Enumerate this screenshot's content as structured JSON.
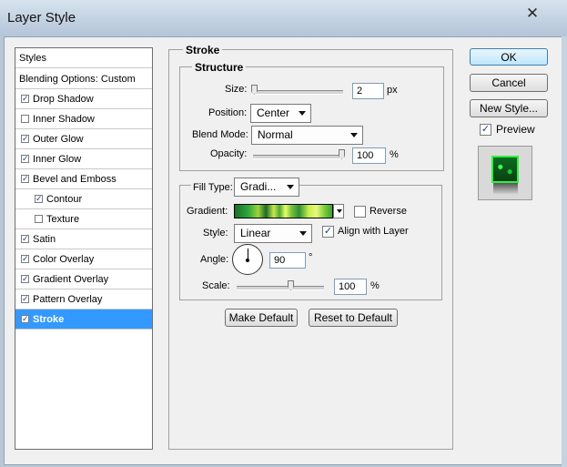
{
  "window": {
    "title": "Layer Style",
    "close_glyph": "✕"
  },
  "styles_panel": {
    "header": "Styles",
    "items": [
      {
        "label": "Blending Options: Custom",
        "checkbox": false
      },
      {
        "label": "Drop Shadow",
        "checkbox": true,
        "checked": true
      },
      {
        "label": "Inner Shadow",
        "checkbox": true,
        "checked": false
      },
      {
        "label": "Outer Glow",
        "checkbox": true,
        "checked": true
      },
      {
        "label": "Inner Glow",
        "checkbox": true,
        "checked": true
      },
      {
        "label": "Bevel and Emboss",
        "checkbox": true,
        "checked": true
      },
      {
        "label": "Contour",
        "checkbox": true,
        "checked": true,
        "sub": true
      },
      {
        "label": "Texture",
        "checkbox": true,
        "checked": false,
        "sub": true
      },
      {
        "label": "Satin",
        "checkbox": true,
        "checked": true
      },
      {
        "label": "Color Overlay",
        "checkbox": true,
        "checked": true
      },
      {
        "label": "Gradient Overlay",
        "checkbox": true,
        "checked": true
      },
      {
        "label": "Pattern Overlay",
        "checkbox": true,
        "checked": true
      },
      {
        "label": "Stroke",
        "checkbox": true,
        "checked": true,
        "selected": true
      }
    ]
  },
  "stroke": {
    "title": "Stroke",
    "structure": {
      "title": "Structure",
      "size_label": "Size:",
      "size_value": "2",
      "size_unit": "px",
      "position_label": "Position:",
      "position_value": "Center",
      "blend_mode_label": "Blend Mode:",
      "blend_mode_value": "Normal",
      "opacity_label": "Opacity:",
      "opacity_value": "100",
      "opacity_unit": "%"
    },
    "fill": {
      "fill_type_label": "Fill Type:",
      "fill_type_value": "Gradi...",
      "gradient_label": "Gradient:",
      "reverse_label": "Reverse",
      "reverse_checked": false,
      "style_label": "Style:",
      "style_value": "Linear",
      "align_label": "Align with Layer",
      "align_checked": true,
      "angle_label": "Angle:",
      "angle_value": "90",
      "angle_unit": "°",
      "scale_label": "Scale:",
      "scale_value": "100",
      "scale_unit": "%"
    },
    "make_default_label": "Make Default",
    "reset_default_label": "Reset to Default"
  },
  "actions": {
    "ok_label": "OK",
    "cancel_label": "Cancel",
    "new_style_label": "New Style...",
    "preview_label": "Preview",
    "preview_checked": true
  },
  "colors": {
    "selection": "#3399ff",
    "dialog_bg": "#f0f0f0"
  }
}
